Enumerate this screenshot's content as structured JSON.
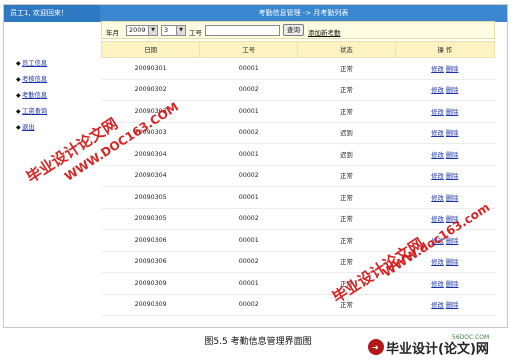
{
  "header": {
    "welcome": "员工1, 欢迎回来！",
    "title": "考勤信息管理 -> 月考勤列表"
  },
  "sidebar": {
    "items": [
      {
        "label": "员工信息"
      },
      {
        "label": "考核信息"
      },
      {
        "label": "考勤信息"
      },
      {
        "label": "工资查询"
      },
      {
        "label": "退出"
      }
    ]
  },
  "filter": {
    "year_month_label": "年月",
    "year": "2009",
    "month": "3",
    "emp_label": "工号",
    "emp_value": "",
    "search_label": "查询",
    "add_link": "添加新考勤"
  },
  "table": {
    "columns": [
      "日期",
      "工号",
      "状态",
      "操 作"
    ],
    "rows": [
      {
        "date": "20090301",
        "emp": "00001",
        "status": "正常"
      },
      {
        "date": "20090302",
        "emp": "00002",
        "status": "正常"
      },
      {
        "date": "20090303",
        "emp": "00001",
        "status": "正常"
      },
      {
        "date": "20090303",
        "emp": "00002",
        "status": "迟到"
      },
      {
        "date": "20090304",
        "emp": "00001",
        "status": "迟到"
      },
      {
        "date": "20090304",
        "emp": "00002",
        "status": "正常"
      },
      {
        "date": "20090305",
        "emp": "00001",
        "status": "正常"
      },
      {
        "date": "20090305",
        "emp": "00002",
        "status": "正常"
      },
      {
        "date": "20090306",
        "emp": "00001",
        "status": "正常"
      },
      {
        "date": "20090306",
        "emp": "00002",
        "status": "正常"
      },
      {
        "date": "20090309",
        "emp": "00001",
        "status": "正常"
      },
      {
        "date": "20090309",
        "emp": "00002",
        "status": "正常"
      }
    ],
    "edit_label": "修改",
    "delete_label": "删除"
  },
  "watermarks": {
    "site": "WWW.DOC163.COM",
    "site_lower": "WWW.doc163.com",
    "brand": "毕业设计论文网",
    "logo_text": "毕业设计(论文)网",
    "logo_site": "56DOC.COM"
  },
  "caption": "图5.5 考勤信息管理界面图",
  "colors": {
    "header_blue": "#3b87cf",
    "watermark_red": "#d21414",
    "filter_bg": "#fdfce2"
  }
}
